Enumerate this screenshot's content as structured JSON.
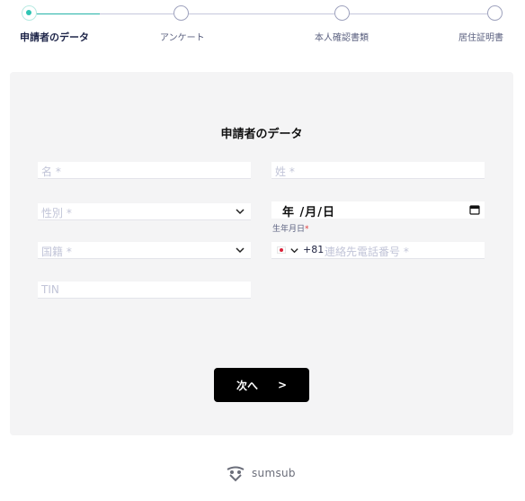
{
  "stepper": {
    "steps": [
      {
        "label": "申請者のデータ"
      },
      {
        "label": "アンケート"
      },
      {
        "label": "本人確認書類"
      },
      {
        "label": "居住証明書"
      }
    ]
  },
  "form": {
    "title": "申請者のデータ",
    "first_name_placeholder": "名 *",
    "last_name_placeholder": "姓 *",
    "gender_placeholder": "性別 *",
    "dob_value": "年 /月/日",
    "dob_label": "生年月日",
    "dob_required": "*",
    "nationality_placeholder": "国籍 *",
    "phone_country_code": "+81",
    "phone_placeholder": "連絡先電話番号 *",
    "tin_placeholder": "TIN",
    "next_label": "次へ",
    "next_arrow": ">"
  },
  "footer": {
    "brand": "sumsub"
  },
  "icons": {
    "chevron": "chevron-down-icon",
    "calendar": "calendar-icon",
    "flag": "japan-flag-icon",
    "logo": "sumsub-logo-icon"
  },
  "colors": {
    "accent": "#2ec5b4",
    "button": "#000000",
    "card": "#f4f4f5"
  }
}
